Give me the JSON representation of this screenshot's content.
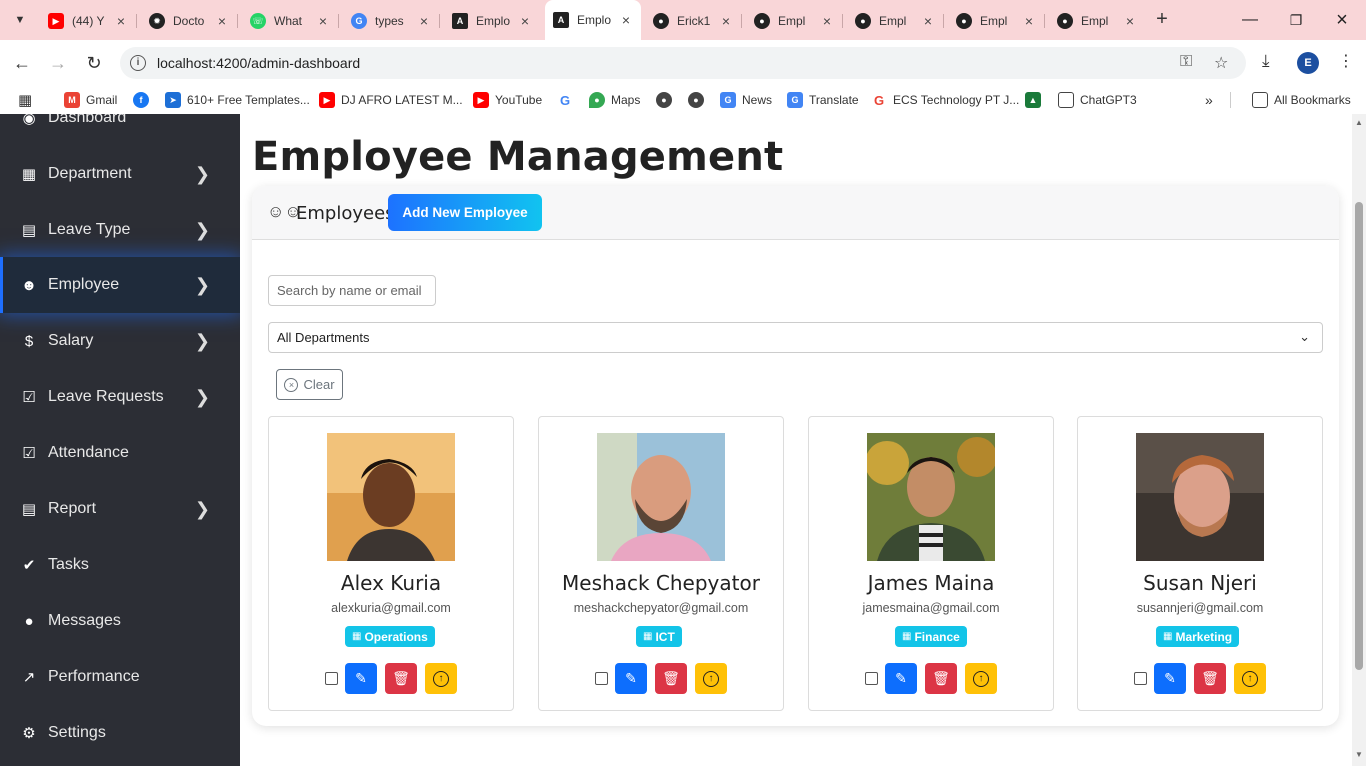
{
  "browser": {
    "tabs": [
      {
        "title": "(44) Y",
        "icon": "youtube-icon"
      },
      {
        "title": "Docto",
        "icon": "openai-icon"
      },
      {
        "title": "What",
        "icon": "whatsapp-icon"
      },
      {
        "title": "types",
        "icon": "google-icon"
      },
      {
        "title": "Emplo",
        "icon": "angular-icon"
      },
      {
        "title": "Emplo",
        "icon": "angular-icon",
        "active": true
      },
      {
        "title": "Erick1",
        "icon": "github-icon"
      },
      {
        "title": "Empl",
        "icon": "github-icon"
      },
      {
        "title": "Empl",
        "icon": "github-icon"
      },
      {
        "title": "Empl",
        "icon": "github-icon"
      },
      {
        "title": "Empl",
        "icon": "github-icon"
      }
    ],
    "url": "localhost:4200/admin-dashboard",
    "profile_initial": "E",
    "bookmarks": [
      {
        "label": "Gmail",
        "icon": "gmail-icon"
      },
      {
        "label": "",
        "icon": "facebook-icon"
      },
      {
        "label": "610+ Free Templates...",
        "icon": "templates-icon"
      },
      {
        "label": "DJ AFRO LATEST M...",
        "icon": "youtube-icon"
      },
      {
        "label": "YouTube",
        "icon": "youtube-icon"
      },
      {
        "label": "",
        "icon": "google-icon"
      },
      {
        "label": "Maps",
        "icon": "maps-icon"
      },
      {
        "label": "",
        "icon": "globe-icon"
      },
      {
        "label": "",
        "icon": "globe-icon"
      },
      {
        "label": "News",
        "icon": "news-icon"
      },
      {
        "label": "Translate",
        "icon": "translate-icon"
      },
      {
        "label": "ECS Technology PT J...",
        "icon": "google-icon"
      },
      {
        "label": "",
        "icon": "bookmark-icon"
      },
      {
        "label": "ChatGPT3",
        "icon": "folder-icon"
      }
    ],
    "all_bookmarks": "All Bookmarks"
  },
  "sidebar": {
    "items": [
      {
        "label": "Dashboard",
        "icon": "dashboard-icon",
        "chevron": false
      },
      {
        "label": "Department",
        "icon": "building-icon",
        "chevron": true
      },
      {
        "label": "Leave Type",
        "icon": "briefcase-icon",
        "chevron": true
      },
      {
        "label": "Employee",
        "icon": "user-circle-icon",
        "chevron": true,
        "active": true
      },
      {
        "label": "Salary",
        "icon": "dollar-icon",
        "chevron": true
      },
      {
        "label": "Leave Requests",
        "icon": "calendar-check-icon",
        "chevron": true
      },
      {
        "label": "Attendance",
        "icon": "calendar-icon",
        "chevron": false
      },
      {
        "label": "Report",
        "icon": "report-icon",
        "chevron": true
      },
      {
        "label": "Tasks",
        "icon": "check-circle-icon",
        "chevron": false
      },
      {
        "label": "Messages",
        "icon": "chat-icon",
        "chevron": false
      },
      {
        "label": "Performance",
        "icon": "chart-line-icon",
        "chevron": false
      },
      {
        "label": "Settings",
        "icon": "gear-icon",
        "chevron": false
      }
    ]
  },
  "main": {
    "title": "Employee Management",
    "card_title": "Employees",
    "add_button": "Add New Employee",
    "search_placeholder": "Search by name or email",
    "department_filter": "All Departments",
    "clear_button": "Clear",
    "employees": [
      {
        "name": "Alex Kuria",
        "email": "alexkuria@gmail.com",
        "department": "Operations"
      },
      {
        "name": "Meshack Chepyator",
        "email": "meshackchepyator@gmail.com",
        "department": "ICT"
      },
      {
        "name": "James Maina",
        "email": "jamesmaina@gmail.com",
        "department": "Finance"
      },
      {
        "name": "Susan Njeri",
        "email": "susannjeri@gmail.com",
        "department": "Marketing"
      }
    ]
  },
  "colors": {
    "sidebar_bg": "#2c2e35",
    "active_glow": "#1e6fff",
    "badge": "#13c4e8",
    "edit": "#0d6efd",
    "delete": "#dc3545",
    "upload": "#ffc107"
  }
}
